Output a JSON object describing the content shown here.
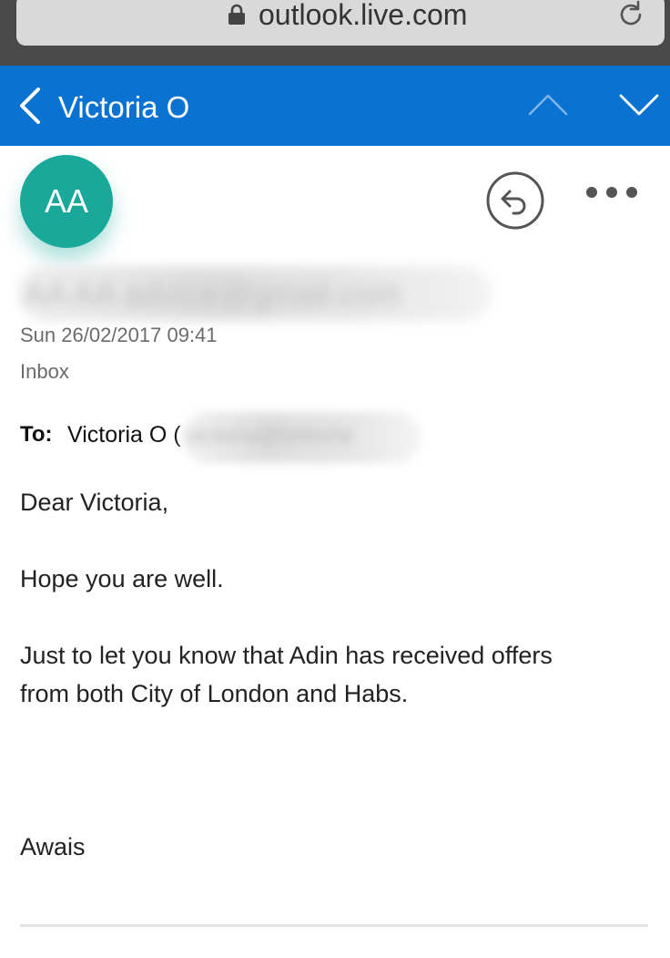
{
  "browser": {
    "url": "outlook.live.com",
    "lock_icon": "lock-icon",
    "reload_icon": "reload-icon"
  },
  "header": {
    "title": "Victoria O",
    "color": "#0a73d2",
    "back_icon": "chevron-left-icon",
    "prev_icon": "chevron-up-icon",
    "next_icon": "chevron-down-icon"
  },
  "message": {
    "avatar_initials": "AA",
    "avatar_color": "#1aa89b",
    "sender_redacted": "AA AA advice@gmail.com",
    "date": "Sun 26/02/2017 09:41",
    "folder": "Inbox",
    "to_label": "To:",
    "to_name": "Victoria O (",
    "to_email_redacted": "victoria@britishe",
    "reply_icon": "reply-icon",
    "more_icon": "more-options-icon",
    "body": {
      "greeting": "Dear Victoria,",
      "line1": "Hope you are well.",
      "line2a": "Just to let you know that Adin has received offers",
      "line2b": "from both City of London and Habs.",
      "signature": "Awais"
    }
  }
}
